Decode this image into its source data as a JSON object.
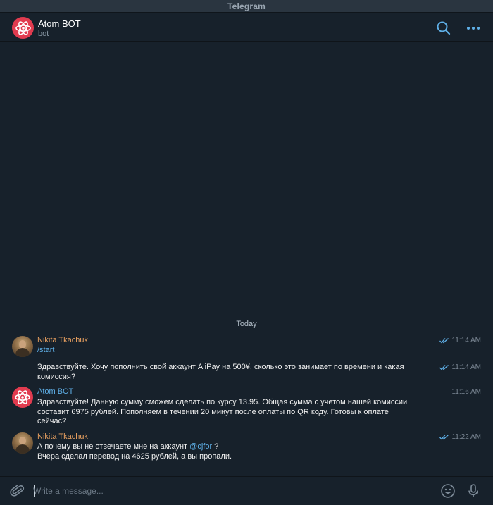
{
  "window": {
    "title": "Telegram"
  },
  "header": {
    "name": "Atom BOT",
    "status": "bot"
  },
  "chat": {
    "date": "Today",
    "messages": [
      {
        "sender": "Nikita Tkachuk",
        "text": "/start",
        "time": "11:14 AM",
        "read": true
      },
      {
        "text": "Здравствуйте. Хочу пополнить свой аккаунт AliPay на 500¥, сколько это занимает по времени и какая комиссия?",
        "time": "11:14 AM",
        "read": true
      },
      {
        "sender": "Atom BOT",
        "text": "Здравствуйте! Данную сумму сможем сделать по курсу 13.95. Общая сумма с учетом нашей комиссии составит 6975 рублей. Пополняем в течении 20 минут после оплаты по QR коду. Готовы к оплате сейчас?",
        "time": "11:16 AM"
      },
      {
        "sender": "Nikita Tkachuk",
        "text_before": "А почему вы не отвечаете мне на аккаунт ",
        "mention": "@cjfor",
        "text_after": " ?",
        "line2": "Вчера сделал перевод на 4625 рублей, а вы пропали.",
        "time": "11:22 AM",
        "read": true
      }
    ]
  },
  "compose": {
    "placeholder": "Write a message..."
  },
  "icons": {
    "search": "search-icon",
    "more": "more-icon",
    "attach": "paperclip-icon",
    "emoji": "emoji-icon",
    "mic": "microphone-icon",
    "bot_avatar": "atom-icon"
  },
  "colors": {
    "accent": "#5fb0e8",
    "user_name": "#e8a060",
    "bot_avatar": "#e13b4f",
    "background": "#17212b"
  }
}
